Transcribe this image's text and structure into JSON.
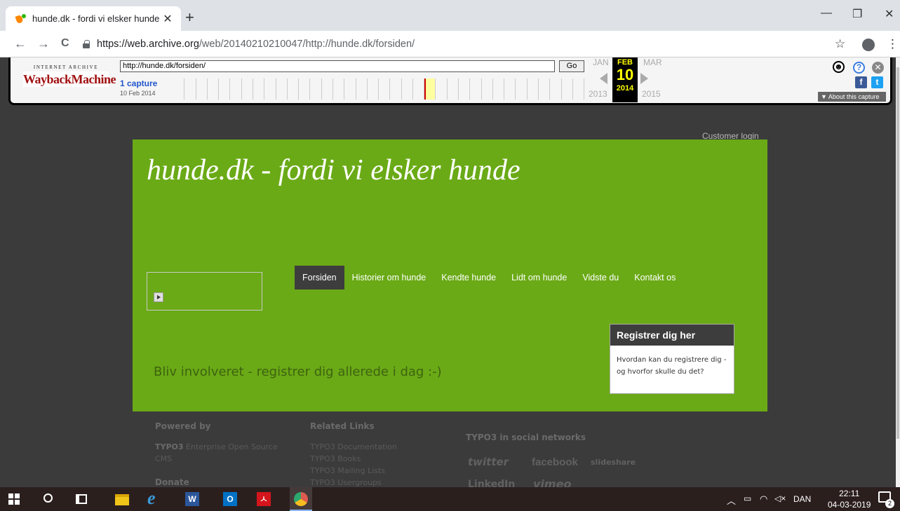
{
  "browser": {
    "tab_title": "hunde.dk - fordi vi elsker hunde",
    "new_tab_symbol": "+",
    "tab_close_symbol": "✕",
    "url_host": "https://web.archive.org",
    "url_path": "/web/20140210210047/http://hunde.dk/forsiden/",
    "back_symbol": "←",
    "forward_symbol": "→",
    "reload_symbol": "C",
    "star_symbol": "☆",
    "menu_symbol": "⋮",
    "minimize_symbol": "—",
    "restore_symbol": "❐",
    "close_symbol": "✕"
  },
  "wayback": {
    "logo_top": "INTERNET ARCHIVE",
    "logo_main": "WaybackMachine",
    "url_input": "http://hunde.dk/forsiden/",
    "go_label": "Go",
    "captures": "1 capture",
    "capture_date": "10 Feb 2014",
    "prev_month": "JAN",
    "cur_month": "FEB",
    "next_month": "MAR",
    "cur_day": "10",
    "prev_year": "2013",
    "cur_year": "2014",
    "next_year": "2015",
    "about_label": "▼ About this capture",
    "user_icon_glyph": "☻",
    "help_icon_glyph": "?",
    "close_icon_glyph": "✕",
    "facebook_glyph": "f",
    "twitter_glyph": "t"
  },
  "page": {
    "customer_login": "Customer login",
    "site_title": "hunde.dk - fordi vi elsker hunde",
    "nav": [
      {
        "label": "Forsiden"
      },
      {
        "label": "Historier om hunde"
      },
      {
        "label": "Kendte hunde"
      },
      {
        "label": "Lidt om hunde"
      },
      {
        "label": "Vidste du"
      },
      {
        "label": "Kontakt os"
      }
    ],
    "register_title": "Registrer dig her",
    "register_body": "Hvordan kan du registrere dig - og hvorfor skulle du det?",
    "involve_text": "Bliv involveret - registrer dig allerede i dag :-)"
  },
  "footer": {
    "powered_by": "Powered by",
    "typo3": "TYPO3",
    "typo3_desc": " Enterprise Open Source CMS",
    "donate": "Donate",
    "related_links": "Related Links",
    "links": [
      "TYPO3 Documentation",
      "TYPO3 Books",
      "TYPO3 Mailing Lists",
      "TYPO3 Usergroups"
    ],
    "social_head": "TYPO3 in social networks",
    "social": [
      "twitter",
      "facebook",
      "slideshare",
      "LinkedIn",
      "vimeo"
    ]
  },
  "taskbar": {
    "time": "22:11",
    "date": "04-03-2019",
    "lang": "DAN",
    "notifications": "2"
  },
  "colors": {
    "site_green": "#6aaa16",
    "page_bg": "#3b3b3b",
    "nav_active": "#3d3d3d",
    "involve_text": "#3e6310"
  }
}
